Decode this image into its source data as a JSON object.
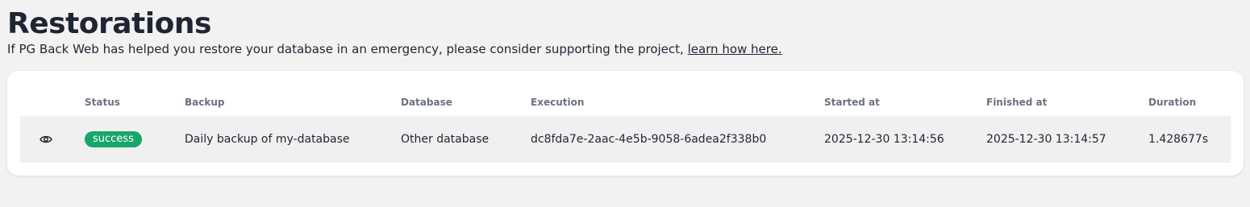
{
  "page": {
    "title": "Restorations",
    "subtitle": "If PG Back Web has helped you restore your database in an emergency, please consider supporting the project, ",
    "link_text": "learn how here."
  },
  "table": {
    "headers": {
      "status": "Status",
      "backup": "Backup",
      "database": "Database",
      "execution": "Execution",
      "started": "Started at",
      "finished": "Finished at",
      "duration": "Duration"
    },
    "rows": [
      {
        "icon": "eye-icon",
        "status": "success",
        "status_color": "#19a66b",
        "backup": "Daily backup of my-database",
        "database": "Other database",
        "execution": "dc8fda7e-2aac-4e5b-9058-6adea2f338b0",
        "started": "2025-12-30 13:14:56",
        "finished": "2025-12-30 13:14:57",
        "duration": "1.428677s"
      }
    ]
  }
}
